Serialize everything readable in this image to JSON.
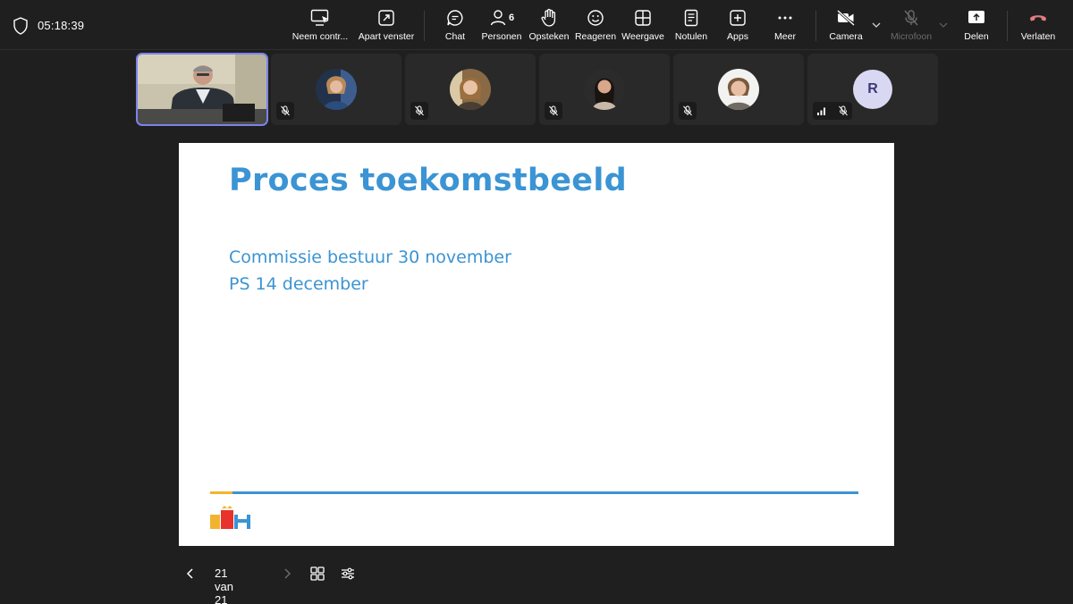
{
  "meeting": {
    "timer": "05:18:39"
  },
  "toolbar": {
    "take_control": "Neem contr...",
    "separate_window": "Apart venster",
    "chat": "Chat",
    "people": "Personen",
    "people_count": "6",
    "raise_hand": "Opsteken",
    "react": "Reageren",
    "view": "Weergave",
    "notes": "Notulen",
    "apps": "Apps",
    "more": "Meer",
    "camera": "Camera",
    "microphone": "Microfoon",
    "share": "Delen",
    "leave": "Verlaten",
    "leave_color": "#e37d80"
  },
  "participants": [
    {
      "type": "video",
      "active": true,
      "muted": false
    },
    {
      "type": "photo",
      "muted": true
    },
    {
      "type": "photo",
      "muted": true
    },
    {
      "type": "photo",
      "muted": true
    },
    {
      "type": "photo",
      "muted": true
    },
    {
      "type": "initial",
      "initial": "R",
      "muted": true,
      "signal": true
    }
  ],
  "slide": {
    "title": "Proces toekomstbeeld",
    "lines": [
      "Commissie bestuur 30 november",
      "PS 14 december"
    ],
    "logo_text": "NH",
    "accent_color": "#3b94d3"
  },
  "slide_nav": {
    "counter": "21 van 21"
  }
}
